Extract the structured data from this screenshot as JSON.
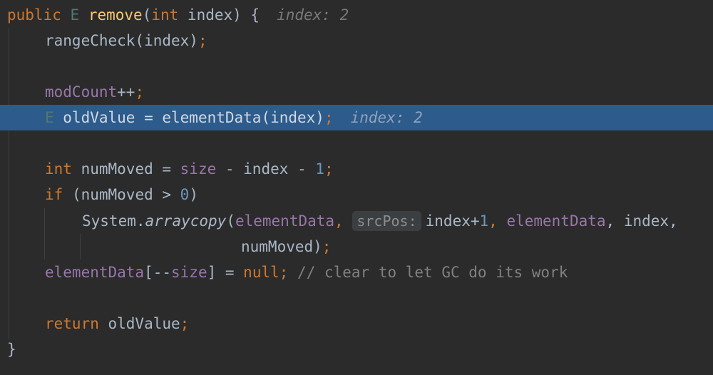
{
  "editor": {
    "colors": {
      "background": "#2b2b2b",
      "current_line": "#2d5b8c",
      "keyword": "#cc7832",
      "method": "#ffc66d",
      "field": "#9876aa",
      "number": "#6897bb",
      "comment": "#808080"
    },
    "lines": {
      "l1": {
        "kw": "public",
        "type": "E",
        "method": "remove",
        "open": "(",
        "ptype": "int",
        "param": " index) {",
        "hint": "index: 2"
      },
      "l2": {
        "call": "rangeCheck(index)",
        "semi": ";"
      },
      "l4": {
        "field": "modCount",
        "op": "++",
        "semi": ";"
      },
      "l5": {
        "type": "E",
        "rest": " oldValue = elementData(index)",
        "semi": ";",
        "hint": "index: 2"
      },
      "l7": {
        "kw": "int",
        "a": " numMoved = ",
        "field": "size",
        "b": " - index - ",
        "num": "1",
        "semi": ";"
      },
      "l8": {
        "kw": "if",
        "a": " (numMoved > ",
        "num": "0",
        "b": ")"
      },
      "l9": {
        "a": "System.",
        "method": "arraycopy",
        "b": "(",
        "field1": "elementData",
        "c": ", ",
        "hint": "srcPos:",
        "d": "index+",
        "num": "1",
        "e": ", ",
        "field2": "elementData",
        "f": ", index,",
        "g": ""
      },
      "l10": {
        "a": "numMoved)",
        "semi": ";"
      },
      "l11": {
        "field1": "elementData",
        "a": "[--",
        "field2": "size",
        "b": "] = ",
        "kw": "null",
        "semi": ";",
        "comment": " // clear to let GC do its work"
      },
      "l13": {
        "kw": "return",
        "a": " oldValue",
        "semi": ";"
      },
      "l14": {
        "a": "}"
      }
    }
  }
}
